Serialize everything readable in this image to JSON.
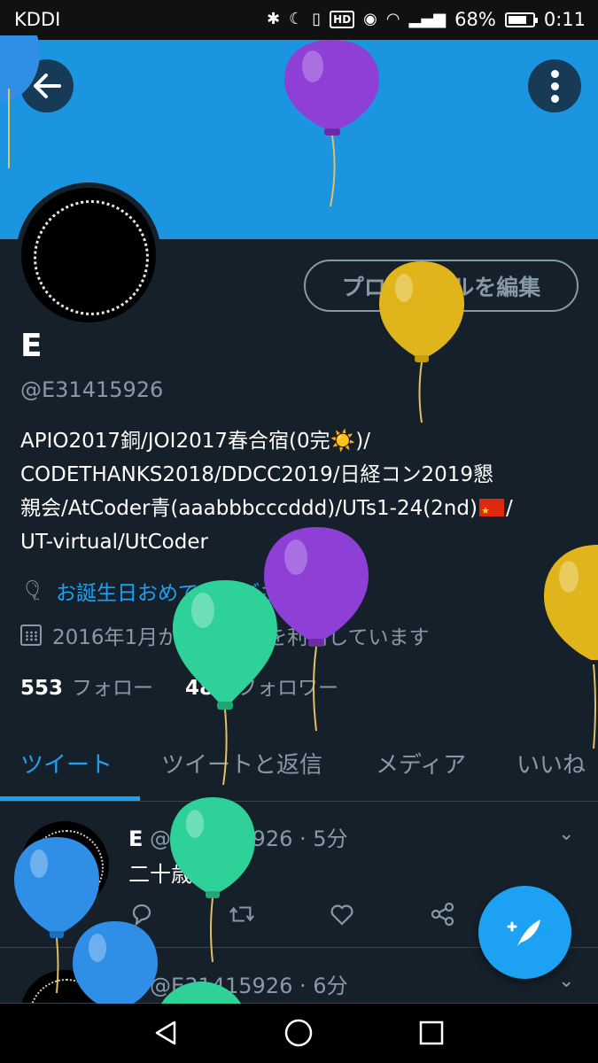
{
  "status_bar": {
    "carrier": "KDDI",
    "battery": "68%",
    "time": "0:11",
    "hd_badge": "HD"
  },
  "header": {
    "back_icon": "arrow-left-icon",
    "more_icon": "more-vertical-icon"
  },
  "profile": {
    "edit_button": "プロフィールを編集",
    "display_name": "E",
    "handle": "@E31415926",
    "bio_lines": [
      "APIO2017銅/JOI2017春合宿(0完☀️)/",
      "CODETHANKS2018/DDCC2019/日経コン2019懇",
      "親会/AtCoder青(aaabbbcccddd)/UTs1-24(2nd)",
      "UT-virtual/UtCoder"
    ],
    "bio_line3_suffix": "/",
    "birthday_text": "お誕生日おめでとうございます。",
    "joined_text": "2016年1月からTwitterを利用しています",
    "following_count": "553",
    "following_label": "フォロー",
    "followers_count": "484",
    "followers_label": "フォロワー"
  },
  "tabs": [
    {
      "label": "ツイート",
      "active": true
    },
    {
      "label": "ツイートと返信",
      "active": false
    },
    {
      "label": "メディア",
      "active": false
    },
    {
      "label": "いいね",
      "active": false
    }
  ],
  "tweets": [
    {
      "name": "E",
      "meta": "@E31415926 · 5分",
      "text": "二十歳"
    },
    {
      "name": "E",
      "meta": "@E31415926 · 6分",
      "text": ""
    }
  ],
  "colors": {
    "accent": "#1da1f2",
    "banner": "#1b95e0",
    "background": "#15202b",
    "muted": "#8899a6",
    "balloon_purple": "#8e3fd6",
    "balloon_yellow": "#e0b51b",
    "balloon_green": "#2ed197",
    "balloon_blue": "#2f8fe6"
  }
}
